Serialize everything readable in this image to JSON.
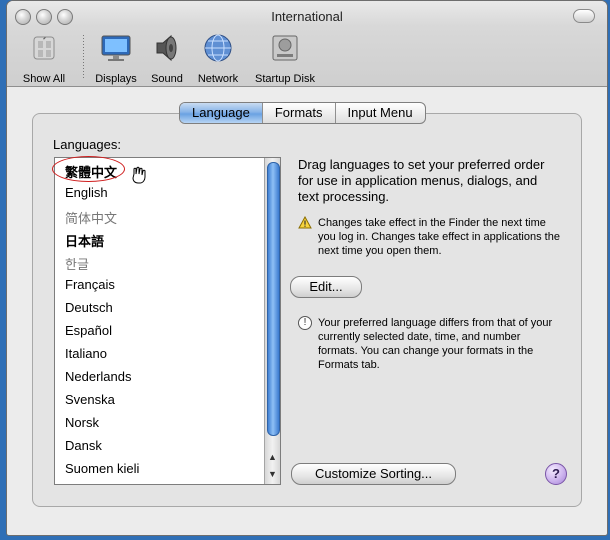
{
  "window": {
    "title": "International"
  },
  "toolbar": {
    "items": [
      {
        "label": "Show All",
        "icon": "apple-switch-icon"
      },
      {
        "label": "Displays",
        "icon": "display-icon"
      },
      {
        "label": "Sound",
        "icon": "speaker-icon"
      },
      {
        "label": "Network",
        "icon": "globe-icon"
      },
      {
        "label": "Startup Disk",
        "icon": "hard-disk-icon"
      }
    ]
  },
  "tabs": [
    {
      "label": "Language",
      "selected": true
    },
    {
      "label": "Formats",
      "selected": false
    },
    {
      "label": "Input Menu",
      "selected": false
    }
  ],
  "languages": {
    "heading": "Languages:",
    "items": [
      "繁體中文",
      "English",
      "简体中文",
      "日本語",
      "한글",
      "Français",
      "Deutsch",
      "Español",
      "Italiano",
      "Nederlands",
      "Svenska",
      "Norsk",
      "Dansk",
      "Suomen kieli"
    ],
    "scroll_fraction_visible": 0.86
  },
  "right_panel": {
    "description": "Drag languages to set your preferred order for use in application menus, dialogs, and text processing.",
    "warning": "Changes take effect in the Finder the next time you log in. Changes take effect in applications the next time you open them.",
    "edit_button": "Edit...",
    "info": "Your preferred language differs from that of your currently selected date, time, and number formats. You can change your formats in the Formats tab.",
    "customize_button": "Customize Sorting...",
    "help_label": "?"
  },
  "colors": {
    "accent_blue": "#6aa2e2",
    "annotation_red": "#cf1d1d",
    "help_purple": "#a482d6"
  }
}
